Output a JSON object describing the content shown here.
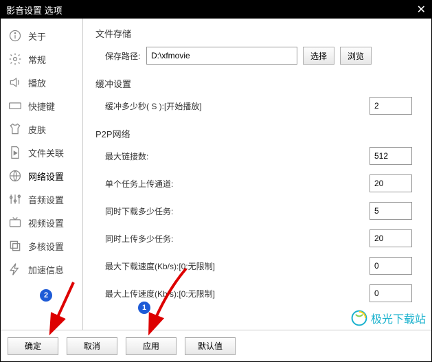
{
  "title": "影音设置 选项",
  "sidebar": {
    "items": [
      {
        "label": "关于"
      },
      {
        "label": "常规"
      },
      {
        "label": "播放"
      },
      {
        "label": "快捷键"
      },
      {
        "label": "皮肤"
      },
      {
        "label": "文件关联"
      },
      {
        "label": "网络设置"
      },
      {
        "label": "音频设置"
      },
      {
        "label": "视频设置"
      },
      {
        "label": "多核设置"
      },
      {
        "label": "加速信息"
      }
    ]
  },
  "sections": {
    "storage": {
      "title": "文件存储",
      "save_path_label": "保存路径:",
      "save_path_value": "D:\\xfmovie",
      "select_btn": "选择",
      "browse_btn": "浏览"
    },
    "buffer": {
      "title": "缓冲设置",
      "label": "缓冲多少秒( S ):[开始播放]",
      "value": "2"
    },
    "p2p": {
      "title": "P2P网络",
      "rows": [
        {
          "label": "最大链接数:",
          "value": "512"
        },
        {
          "label": "单个任务上传通道:",
          "value": "20"
        },
        {
          "label": "同时下载多少任务:",
          "value": "5"
        },
        {
          "label": "同时上传多少任务:",
          "value": "20"
        },
        {
          "label": "最大下载速度(Kb/s):[0:无限制]",
          "value": "0"
        },
        {
          "label": "最大上传速度(Kb/s):[0:无限制]",
          "value": "0"
        }
      ]
    }
  },
  "footer": {
    "ok": "确定",
    "cancel": "取消",
    "apply": "应用",
    "default": "默认值"
  },
  "annotations": {
    "badge1": "1",
    "badge2": "2"
  },
  "watermark": "极光下载站"
}
